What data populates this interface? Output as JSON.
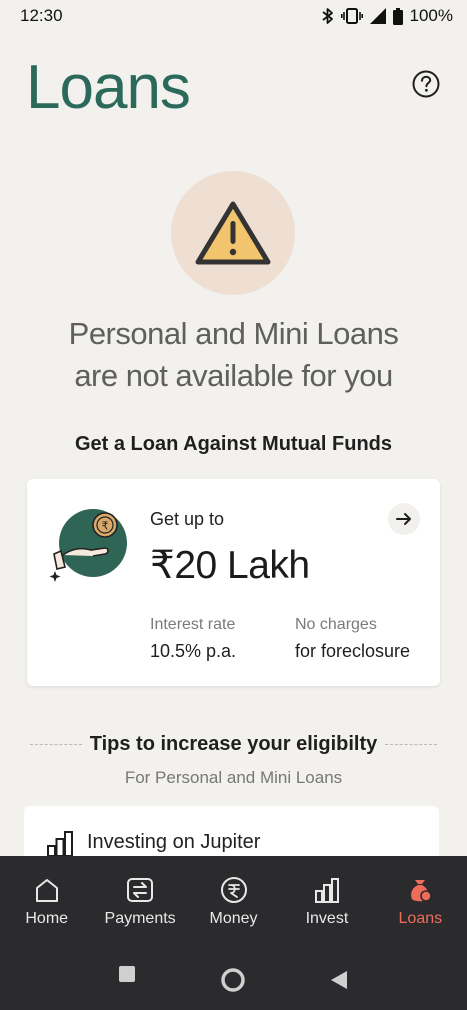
{
  "status_bar": {
    "time": "12:30",
    "battery": "100%"
  },
  "header": {
    "title": "Loans",
    "help_icon": "question-circle-icon"
  },
  "warning": {
    "icon": "warning-triangle-icon",
    "line1": "Personal and Mini Loans",
    "line2": "are not available for you"
  },
  "offer": {
    "section_title": "Get a Loan Against Mutual Funds",
    "subtitle": "Get up to",
    "amount": "₹20 Lakh",
    "interest_label": "Interest rate",
    "interest_value": "10.5% p.a.",
    "charges_label": "No charges",
    "charges_value": "for foreclosure",
    "arrow_icon": "arrow-right-icon"
  },
  "tips": {
    "title": "Tips to increase your eligibilty",
    "subtitle": "For Personal and Mini Loans",
    "items": [
      {
        "label": "Investing on Jupiter",
        "icon": "bar-chart-icon"
      }
    ]
  },
  "bottom_nav": {
    "items": [
      {
        "label": "Home",
        "icon": "home-icon"
      },
      {
        "label": "Payments",
        "icon": "payments-icon"
      },
      {
        "label": "Money",
        "icon": "rupee-coin-icon"
      },
      {
        "label": "Invest",
        "icon": "invest-bars-icon"
      },
      {
        "label": "Loans",
        "icon": "money-bag-icon",
        "active": true
      }
    ]
  },
  "colors": {
    "brand_green": "#2b6a5a",
    "active_nav": "#ee6c5a",
    "nav_bg": "#2b2b2e",
    "warning_yellow": "#f2c46d"
  }
}
